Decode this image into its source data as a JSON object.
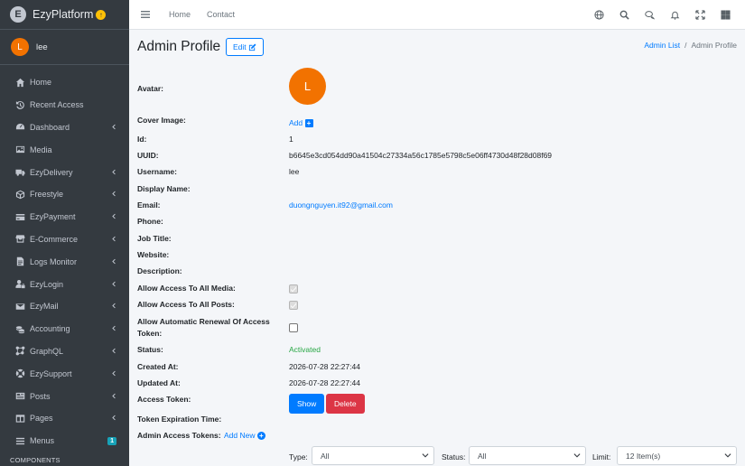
{
  "brand": {
    "logo_letter": "E",
    "name": "EzyPlatform",
    "badge": "↑"
  },
  "user": {
    "avatar_letter": "L",
    "name": "lee"
  },
  "sidebar": {
    "items": [
      {
        "label": "Home",
        "icon": "home-icon",
        "chevron": false
      },
      {
        "label": "Recent Access",
        "icon": "history-icon",
        "chevron": false
      },
      {
        "label": "Dashboard",
        "icon": "dashboard-icon",
        "chevron": true
      },
      {
        "label": "Media",
        "icon": "image-icon",
        "chevron": false
      },
      {
        "label": "EzyDelivery",
        "icon": "truck-icon",
        "chevron": true
      },
      {
        "label": "Freestyle",
        "icon": "cube-icon",
        "chevron": true
      },
      {
        "label": "EzyPayment",
        "icon": "credit-card-icon",
        "chevron": true
      },
      {
        "label": "E-Commerce",
        "icon": "shop-icon",
        "chevron": true
      },
      {
        "label": "Logs Monitor",
        "icon": "file-icon",
        "chevron": true
      },
      {
        "label": "EzyLogin",
        "icon": "user-lock-icon",
        "chevron": true
      },
      {
        "label": "EzyMail",
        "icon": "envelope-icon",
        "chevron": true
      },
      {
        "label": "Accounting",
        "icon": "coins-icon",
        "chevron": true
      },
      {
        "label": "GraphQL",
        "icon": "graph-icon",
        "chevron": true
      },
      {
        "label": "EzySupport",
        "icon": "support-icon",
        "chevron": true
      },
      {
        "label": "Posts",
        "icon": "posts-icon",
        "chevron": true
      },
      {
        "label": "Pages",
        "icon": "pages-icon",
        "chevron": true
      },
      {
        "label": "Menus",
        "icon": "menu-icon",
        "chevron": false,
        "badge": "1"
      }
    ],
    "header": "COMPONENTS"
  },
  "topbar": {
    "home": "Home",
    "contact": "Contact"
  },
  "page": {
    "title": "Admin Profile",
    "edit_label": "Edit"
  },
  "breadcrumb": {
    "parent": "Admin List",
    "current": "Admin Profile"
  },
  "profile": {
    "avatar_label": "Avatar:",
    "avatar_letter": "L",
    "cover_label": "Cover Image:",
    "cover_add": "Add",
    "id_label": "Id:",
    "id_value": "1",
    "uuid_label": "UUID:",
    "uuid_value": "b6645e3cd054dd90a41504c27334a56c1785e5798c5e06ff4730d48f28d08f69",
    "username_label": "Username:",
    "username_value": "lee",
    "display_name_label": "Display Name:",
    "email_label": "Email:",
    "email_value": "duongnguyen.it92@gmail.com",
    "phone_label": "Phone:",
    "job_label": "Job Title:",
    "website_label": "Website:",
    "description_label": "Description:",
    "allow_media_label": "Allow Access To All Media:",
    "allow_posts_label": "Allow Access To All Posts:",
    "renewal_label_1": "Allow Automatic Renewal Of Access",
    "renewal_label_2": "Token:",
    "status_label": "Status:",
    "status_value": "Activated",
    "created_label": "Created At:",
    "created_value": "2026-07-28 22:27:44",
    "updated_label": "Updated At:",
    "updated_value": "2026-07-28 22:27:44",
    "token_label": "Access Token:",
    "show_label": "Show",
    "delete_label": "Delete",
    "expiration_label": "Token Expiration Time:",
    "admin_tokens_label": "Admin Access Tokens:",
    "add_new": "Add New"
  },
  "filters": {
    "type_label": "Type:",
    "type_value": "All",
    "status_label": "Status:",
    "status_value": "All",
    "limit_label": "Limit:",
    "limit_value": "12 Item(s)"
  }
}
